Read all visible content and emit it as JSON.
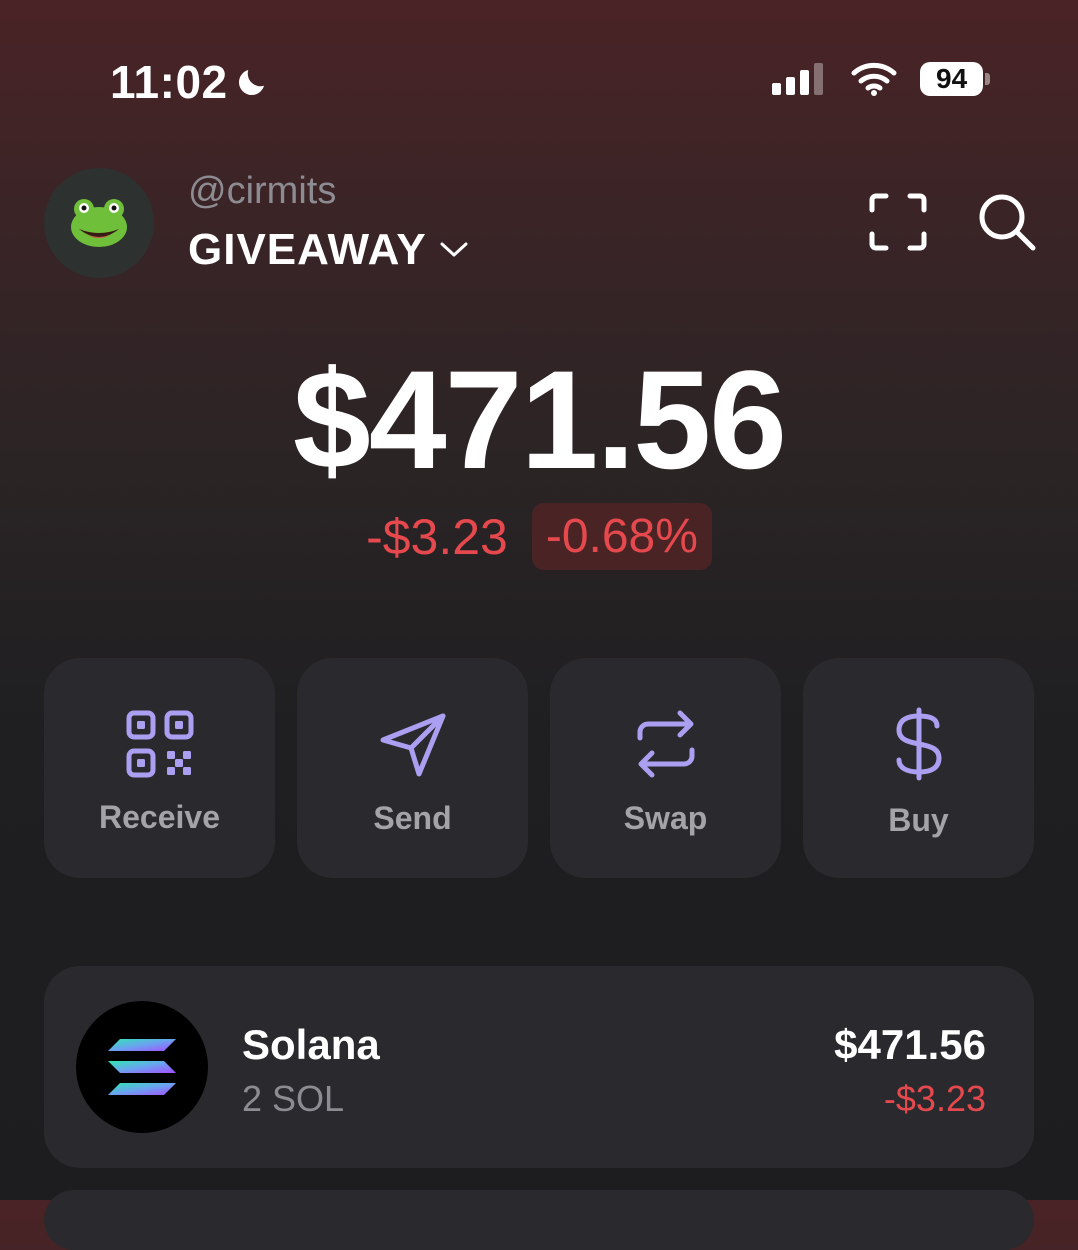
{
  "status_bar": {
    "time": "11:02",
    "battery": "94"
  },
  "account": {
    "avatar_emoji": "🐸",
    "handle": "@cirmits",
    "name": "GIVEAWAY"
  },
  "balance": {
    "total": "$471.56",
    "change_abs": "-$3.23",
    "change_pct": "-0.68%"
  },
  "actions": [
    {
      "label": "Receive",
      "icon": "qr-code-icon"
    },
    {
      "label": "Send",
      "icon": "send-icon"
    },
    {
      "label": "Swap",
      "icon": "swap-icon"
    },
    {
      "label": "Buy",
      "icon": "dollar-icon"
    }
  ],
  "tokens": [
    {
      "name": "Solana",
      "amount": "2 SOL",
      "value": "$471.56",
      "change": "-$3.23",
      "icon": "solana-logo-icon"
    }
  ],
  "colors": {
    "accent": "#ab9ff2",
    "negative": "#e5484d",
    "card": "#2a2a2e",
    "muted": "#8c8c92"
  }
}
